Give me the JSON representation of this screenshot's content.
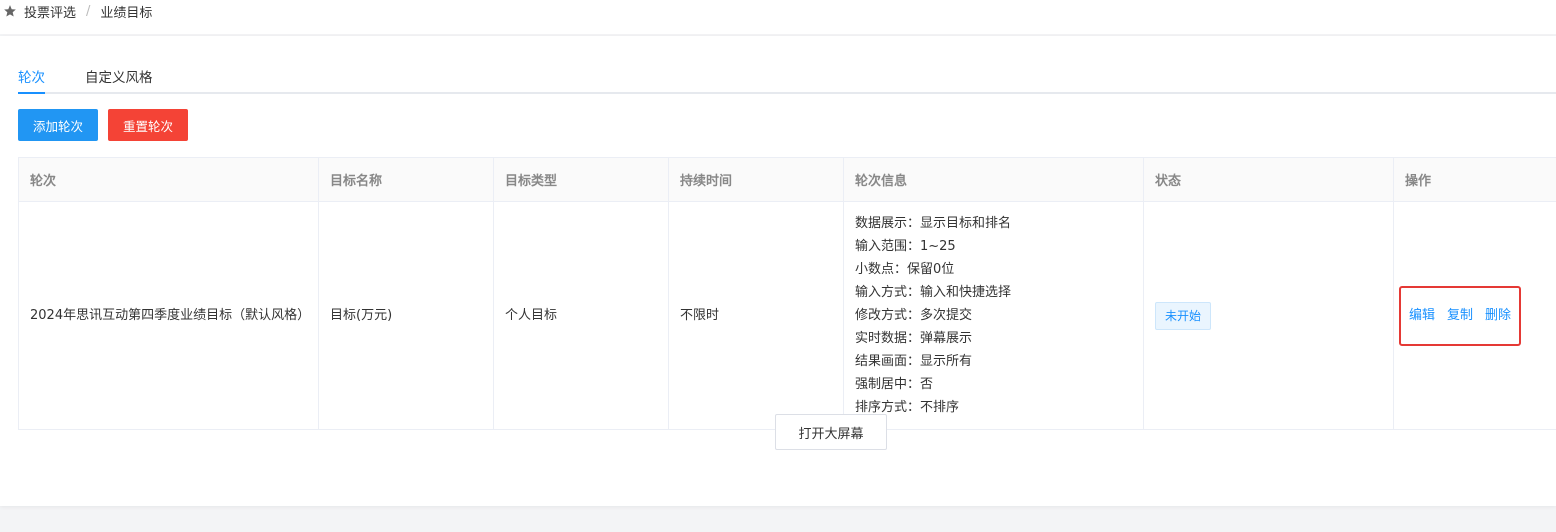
{
  "breadcrumb": {
    "root": "投票评选",
    "separator": "/",
    "current": "业绩目标"
  },
  "tabs": [
    {
      "label": "轮次",
      "active": true
    },
    {
      "label": "自定义风格",
      "active": false
    }
  ],
  "toolbar": {
    "add_label": "添加轮次",
    "reset_label": "重置轮次"
  },
  "table": {
    "headers": [
      "轮次",
      "目标名称",
      "目标类型",
      "持续时间",
      "轮次信息",
      "状态",
      "操作"
    ],
    "rows": [
      {
        "round": "2024年思讯互动第四季度业绩目标（默认风格）",
        "target_name": "目标(万元)",
        "target_type": "个人目标",
        "duration": "不限时",
        "info": [
          "数据展示：显示目标和排名",
          "输入范围：1~25",
          "小数点：保留0位",
          "输入方式：输入和快捷选择",
          "修改方式：多次提交",
          "实时数据：弹幕展示",
          "结果画面：显示所有",
          "强制居中：否",
          "排序方式：不排序"
        ],
        "status": "未开始",
        "ops": {
          "edit": "编辑",
          "copy": "复制",
          "delete": "删除"
        }
      }
    ]
  },
  "footer": {
    "open_big_screen": "打开大屏幕"
  },
  "colors": {
    "primary": "#2196f3",
    "danger": "#f44336",
    "link": "#1890ff",
    "highlight_box": "#e53935"
  }
}
